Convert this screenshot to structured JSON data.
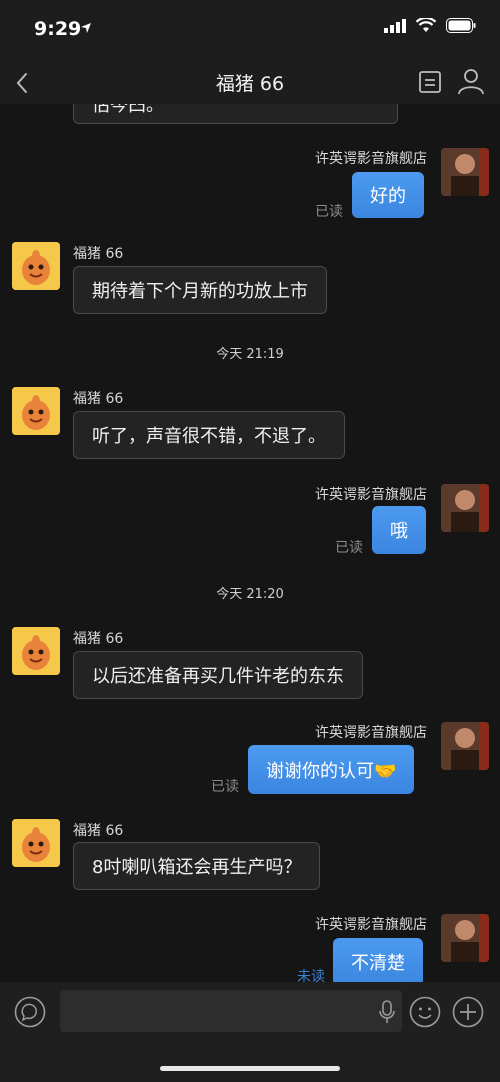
{
  "status": {
    "time": "9:29"
  },
  "header": {
    "title": "福猪 66"
  },
  "messages": {
    "m0": {
      "text": "估岑臼。"
    },
    "m1": {
      "sender": "许英谔影音旗舰店",
      "text": "好的",
      "status": "已读"
    },
    "m2": {
      "sender": "福猪 66",
      "text": "期待着下个月新的功放上市"
    },
    "t1": {
      "text": "今天 21:19"
    },
    "m3": {
      "sender": "福猪 66",
      "text": "听了，声音很不错，不退了。"
    },
    "m4": {
      "sender": "许英谔影音旗舰店",
      "text": "哦",
      "status": "已读"
    },
    "t2": {
      "text": "今天 21:20"
    },
    "m5": {
      "sender": "福猪 66",
      "text": "以后还准备再买几件许老的东东"
    },
    "m6": {
      "sender": "许英谔影音旗舰店",
      "text": "谢谢你的认可🤝",
      "status": "已读"
    },
    "m7": {
      "sender": "福猪 66",
      "text": "8吋喇叭箱还会再生产吗？"
    },
    "m8": {
      "sender": "许英谔影音旗舰店",
      "text": "不清楚",
      "status": "未读"
    }
  },
  "input": {
    "placeholder": ""
  },
  "colors": {
    "bubble_out": "#4290e8",
    "bubble_in": "#232323",
    "background": "#151515",
    "unread": "#3a82d6"
  }
}
